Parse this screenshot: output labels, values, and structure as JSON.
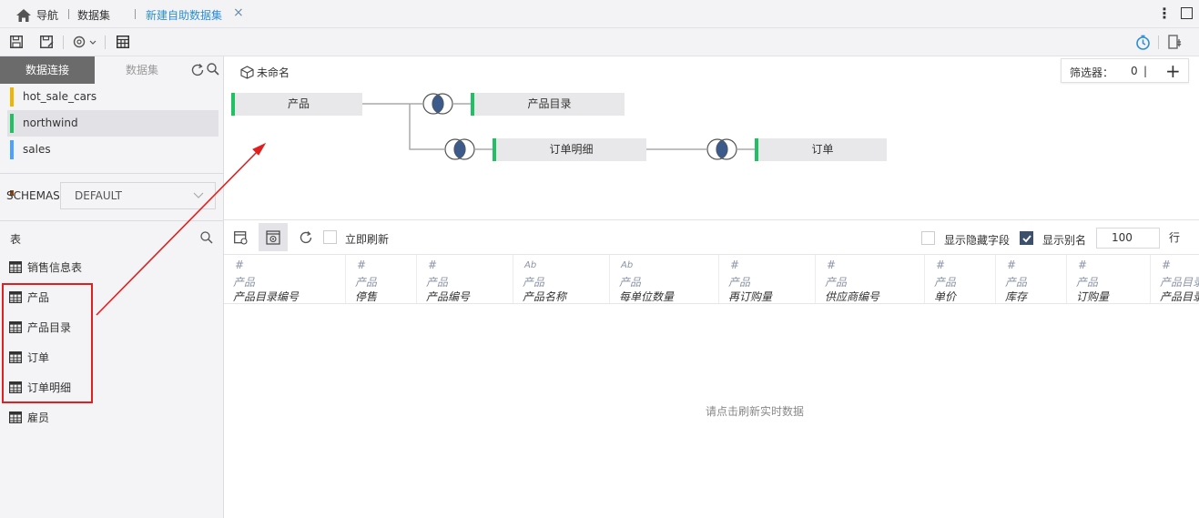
{
  "topbar": {
    "nav_label": "导航",
    "crumb": "数据集",
    "active_tab": "新建自助数据集",
    "close": "×"
  },
  "left": {
    "tab_connections": "数据连接",
    "tab_datasets": "数据集",
    "connections": [
      {
        "name": "hot_sale_cars",
        "color": "#f0b500"
      },
      {
        "name": "northwind",
        "color": "#20c163",
        "selected": true
      },
      {
        "name": "sales",
        "color": "#4aa3ff"
      }
    ],
    "schemas_label": "SCHEMAS",
    "schemas_value": "DEFAULT",
    "tables_title": "表",
    "tables": [
      "销售信息表",
      "产品",
      "产品目录",
      "订单",
      "订单明细",
      "雇员"
    ]
  },
  "canvas": {
    "title": "未命名",
    "filter_label": "筛选器：",
    "filter_count": "0",
    "nodes": {
      "product": "产品",
      "category": "产品目录",
      "order_detail": "订单明细",
      "order": "订单"
    }
  },
  "gridbar": {
    "refresh_now": "立即刷新",
    "show_hidden": "显示隐藏字段",
    "show_alias": "显示别名",
    "show_alias_checked": true,
    "row_count": "100",
    "row_unit": "行"
  },
  "columns": [
    {
      "type": "#",
      "source": "产品",
      "name": "产品目录编号"
    },
    {
      "type": "#",
      "source": "产品",
      "name": "停售"
    },
    {
      "type": "#",
      "source": "产品",
      "name": "产品编号"
    },
    {
      "type": "Ab",
      "source": "产品",
      "name": "产品名称"
    },
    {
      "type": "Ab",
      "source": "产品",
      "name": "每单位数量"
    },
    {
      "type": "#",
      "source": "产品",
      "name": "再订购量"
    },
    {
      "type": "#",
      "source": "产品",
      "name": "供应商编号"
    },
    {
      "type": "#",
      "source": "产品",
      "name": "单价"
    },
    {
      "type": "#",
      "source": "产品",
      "name": "库存"
    },
    {
      "type": "#",
      "source": "产品",
      "name": "订购量"
    },
    {
      "type": "#",
      "source": "产品目录",
      "name": "产品目录"
    }
  ],
  "empty_message": "请点击刷新实时数据"
}
